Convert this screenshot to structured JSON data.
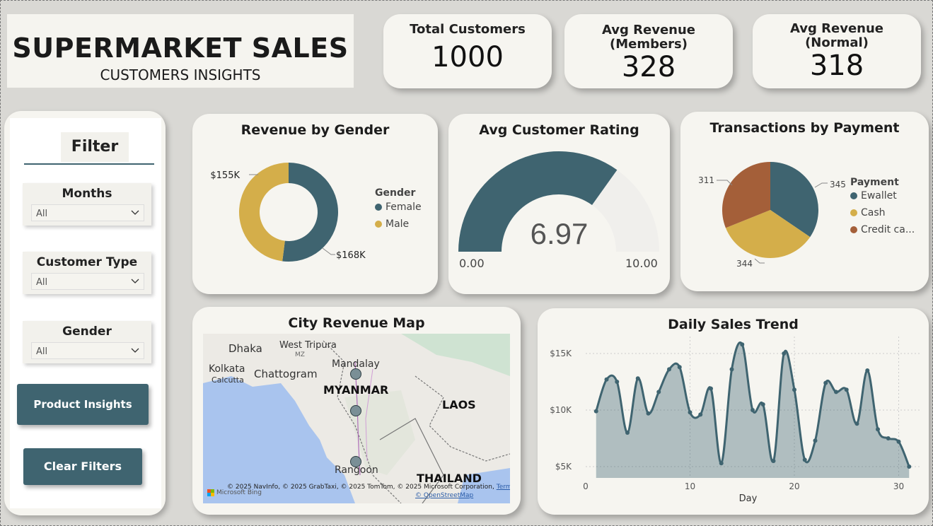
{
  "header": {
    "title": "SUPERMARKET SALES",
    "subtitle": "CUSTOMERS INSIGHTS"
  },
  "kpis": [
    {
      "label": "Total Customers",
      "value": "1000"
    },
    {
      "label_line1": "Avg Revenue",
      "label_line2": "(Members)",
      "value": "328"
    },
    {
      "label_line1": "Avg Revenue",
      "label_line2": "(Normal)",
      "value": "318"
    }
  ],
  "filters": {
    "title": "Filter",
    "slicers": [
      {
        "label": "Months",
        "value": "All"
      },
      {
        "label": "Customer Type",
        "value": "All"
      },
      {
        "label": "Gender",
        "value": "All"
      }
    ],
    "product_insights_label": "Product Insights",
    "clear_filters_label": "Clear Filters"
  },
  "colors": {
    "teal": "#3f6470",
    "gold": "#d4ae4a",
    "rust": "#a45f39",
    "panel": "#f6f5f0"
  },
  "chart_data": [
    {
      "type": "pie",
      "title": "Revenue by Gender",
      "legend_title": "Gender",
      "legend_position": "right",
      "slices": [
        {
          "name": "Female",
          "value": 168,
          "label": "$168K",
          "color": "#3f6470"
        },
        {
          "name": "Male",
          "value": 155,
          "label": "$155K",
          "color": "#d4ae4a"
        }
      ]
    },
    {
      "type": "gauge",
      "title": "Avg Customer Rating",
      "value": 6.97,
      "value_label": "6.97",
      "min_label": "0.00",
      "max_label": "10.00",
      "min": 0,
      "max": 10
    },
    {
      "type": "pie",
      "title": "Transactions by Payment",
      "legend_title": "Payment",
      "legend_position": "right",
      "slices": [
        {
          "name": "Ewallet",
          "value": 345,
          "label": "345",
          "color": "#3f6470"
        },
        {
          "name": "Cash",
          "value": 344,
          "label": "344",
          "color": "#d4ae4a"
        },
        {
          "name": "Credit ca...",
          "value": 311,
          "label": "311",
          "color": "#a45f39"
        }
      ]
    },
    {
      "type": "area",
      "title": "Daily Sales Trend",
      "xlabel": "Day",
      "ylabel": "",
      "xlim": [
        0,
        32
      ],
      "ylim": [
        4000,
        16500
      ],
      "x_ticks": [
        "0",
        "10",
        "20",
        "30"
      ],
      "y_ticks": [
        "$5K",
        "$10K",
        "$15K"
      ],
      "grid": true,
      "series": [
        {
          "x": [
            1,
            2,
            3,
            4,
            5,
            6,
            7,
            8,
            9,
            10,
            11,
            12,
            13,
            14,
            15,
            16,
            17,
            18,
            19,
            20,
            21,
            22,
            23,
            24,
            25,
            26,
            27,
            28,
            29,
            30,
            31
          ],
          "values": [
            9900,
            12700,
            12500,
            8000,
            12800,
            9700,
            11600,
            13600,
            13800,
            9800,
            9600,
            11900,
            5300,
            13600,
            15800,
            10000,
            10500,
            5500,
            15000,
            11800,
            5600,
            7300,
            12400,
            11600,
            11800,
            8800,
            13500,
            8300,
            7500,
            7200,
            5000
          ]
        }
      ]
    }
  ],
  "map": {
    "title": "City Revenue Map",
    "labels": {
      "dhaka": "Dhaka",
      "west_tripura": "West Tripura",
      "mz": "MZ",
      "kolkata": "Kolkata",
      "calcutta": "Calcutta",
      "chattogram": "Chattogram",
      "mandalay": "Mandalay",
      "myanmar": "MYANMAR",
      "laos": "LAOS",
      "rangoon": "Rangoon",
      "thailand": "THAILAND"
    },
    "attribution": "© 2025 NavInfo, © 2025 GrabTaxi, © 2025 TomTom, © 2025 Microsoft Corporation,",
    "terms": "Terms",
    "osm": "© OpenStreetMap",
    "brand": "Microsoft Bing"
  }
}
